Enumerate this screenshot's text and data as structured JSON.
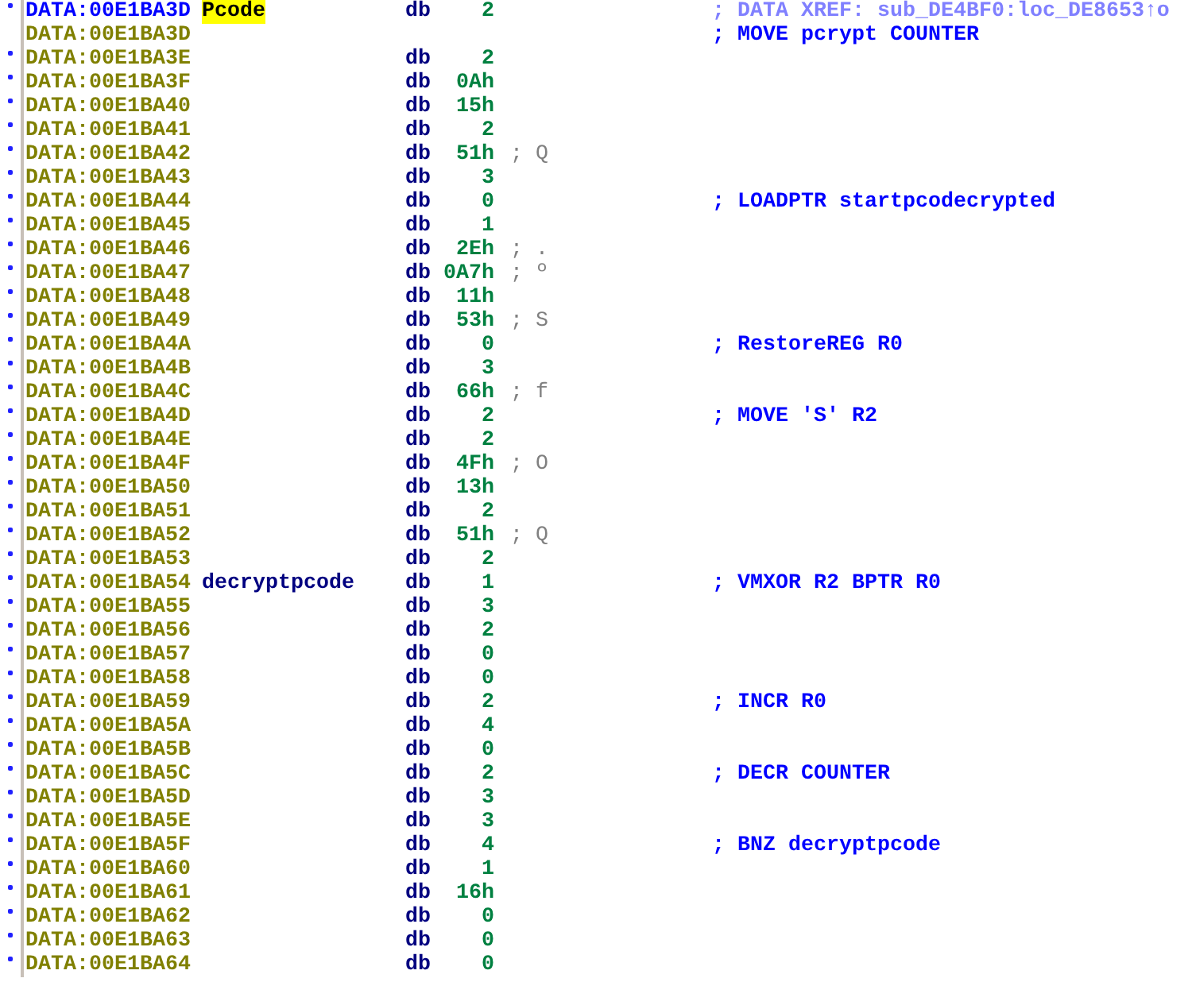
{
  "lines": [
    {
      "address": "DATA:00E1BA3D",
      "selected": true,
      "marked": true,
      "label": "Pcode",
      "label_highlighted": true,
      "op": "db",
      "value": "2",
      "comment": {
        "kind": "xref",
        "text": "; DATA XREF: sub_DE4BF0:loc_DE8653↑o"
      }
    },
    {
      "address": "DATA:00E1BA3D",
      "selected": false,
      "marked": false,
      "comment": {
        "kind": "note",
        "text": "; MOVE pcrypt COUNTER"
      }
    },
    {
      "address": "DATA:00E1BA3E",
      "selected": false,
      "marked": true,
      "op": "db",
      "value": "2"
    },
    {
      "address": "DATA:00E1BA3F",
      "selected": false,
      "marked": true,
      "op": "db",
      "value": "0Ah"
    },
    {
      "address": "DATA:00E1BA40",
      "selected": false,
      "marked": true,
      "op": "db",
      "value": "15h"
    },
    {
      "address": "DATA:00E1BA41",
      "selected": false,
      "marked": true,
      "op": "db",
      "value": "2"
    },
    {
      "address": "DATA:00E1BA42",
      "selected": false,
      "marked": true,
      "op": "db",
      "value": "51h",
      "char": "; Q"
    },
    {
      "address": "DATA:00E1BA43",
      "selected": false,
      "marked": true,
      "op": "db",
      "value": "3"
    },
    {
      "address": "DATA:00E1BA44",
      "selected": false,
      "marked": true,
      "op": "db",
      "value": "0",
      "comment": {
        "kind": "note",
        "text": "; LOADPTR startpcodecrypted"
      }
    },
    {
      "address": "DATA:00E1BA45",
      "selected": false,
      "marked": true,
      "op": "db",
      "value": "1"
    },
    {
      "address": "DATA:00E1BA46",
      "selected": false,
      "marked": true,
      "op": "db",
      "value": "2Eh",
      "char": "; ."
    },
    {
      "address": "DATA:00E1BA47",
      "selected": false,
      "marked": true,
      "op": "db",
      "value": "0A7h",
      "char": "; º"
    },
    {
      "address": "DATA:00E1BA48",
      "selected": false,
      "marked": true,
      "op": "db",
      "value": "11h"
    },
    {
      "address": "DATA:00E1BA49",
      "selected": false,
      "marked": true,
      "op": "db",
      "value": "53h",
      "char": "; S"
    },
    {
      "address": "DATA:00E1BA4A",
      "selected": false,
      "marked": true,
      "op": "db",
      "value": "0",
      "comment": {
        "kind": "note",
        "text": "; RestoreREG R0"
      }
    },
    {
      "address": "DATA:00E1BA4B",
      "selected": false,
      "marked": true,
      "op": "db",
      "value": "3"
    },
    {
      "address": "DATA:00E1BA4C",
      "selected": false,
      "marked": true,
      "op": "db",
      "value": "66h",
      "char": "; f"
    },
    {
      "address": "DATA:00E1BA4D",
      "selected": false,
      "marked": true,
      "op": "db",
      "value": "2",
      "comment": {
        "kind": "note",
        "text": "; MOVE 'S' R2"
      }
    },
    {
      "address": "DATA:00E1BA4E",
      "selected": false,
      "marked": true,
      "op": "db",
      "value": "2"
    },
    {
      "address": "DATA:00E1BA4F",
      "selected": false,
      "marked": true,
      "op": "db",
      "value": "4Fh",
      "char": "; O"
    },
    {
      "address": "DATA:00E1BA50",
      "selected": false,
      "marked": true,
      "op": "db",
      "value": "13h"
    },
    {
      "address": "DATA:00E1BA51",
      "selected": false,
      "marked": true,
      "op": "db",
      "value": "2"
    },
    {
      "address": "DATA:00E1BA52",
      "selected": false,
      "marked": true,
      "op": "db",
      "value": "51h",
      "char": "; Q"
    },
    {
      "address": "DATA:00E1BA53",
      "selected": false,
      "marked": true,
      "op": "db",
      "value": "2"
    },
    {
      "address": "DATA:00E1BA54",
      "selected": false,
      "marked": true,
      "label": "decryptpcode",
      "label_highlighted": false,
      "op": "db",
      "value": "1",
      "comment": {
        "kind": "note",
        "text": "; VMXOR R2 BPTR R0"
      }
    },
    {
      "address": "DATA:00E1BA55",
      "selected": false,
      "marked": true,
      "op": "db",
      "value": "3"
    },
    {
      "address": "DATA:00E1BA56",
      "selected": false,
      "marked": true,
      "op": "db",
      "value": "2"
    },
    {
      "address": "DATA:00E1BA57",
      "selected": false,
      "marked": true,
      "op": "db",
      "value": "0"
    },
    {
      "address": "DATA:00E1BA58",
      "selected": false,
      "marked": true,
      "op": "db",
      "value": "0"
    },
    {
      "address": "DATA:00E1BA59",
      "selected": false,
      "marked": true,
      "op": "db",
      "value": "2",
      "comment": {
        "kind": "note",
        "text": "; INCR R0"
      }
    },
    {
      "address": "DATA:00E1BA5A",
      "selected": false,
      "marked": true,
      "op": "db",
      "value": "4"
    },
    {
      "address": "DATA:00E1BA5B",
      "selected": false,
      "marked": true,
      "op": "db",
      "value": "0"
    },
    {
      "address": "DATA:00E1BA5C",
      "selected": false,
      "marked": true,
      "op": "db",
      "value": "2",
      "comment": {
        "kind": "note",
        "text": "; DECR COUNTER"
      }
    },
    {
      "address": "DATA:00E1BA5D",
      "selected": false,
      "marked": true,
      "op": "db",
      "value": "3"
    },
    {
      "address": "DATA:00E1BA5E",
      "selected": false,
      "marked": true,
      "op": "db",
      "value": "3"
    },
    {
      "address": "DATA:00E1BA5F",
      "selected": false,
      "marked": true,
      "op": "db",
      "value": "4",
      "comment": {
        "kind": "note",
        "text": "; BNZ decryptpcode"
      }
    },
    {
      "address": "DATA:00E1BA60",
      "selected": false,
      "marked": true,
      "op": "db",
      "value": "1"
    },
    {
      "address": "DATA:00E1BA61",
      "selected": false,
      "marked": true,
      "op": "db",
      "value": "16h"
    },
    {
      "address": "DATA:00E1BA62",
      "selected": false,
      "marked": true,
      "op": "db",
      "value": "0"
    },
    {
      "address": "DATA:00E1BA63",
      "selected": false,
      "marked": true,
      "op": "db",
      "value": "0"
    },
    {
      "address": "DATA:00E1BA64",
      "selected": false,
      "marked": true,
      "op": "db",
      "value": "0"
    }
  ]
}
